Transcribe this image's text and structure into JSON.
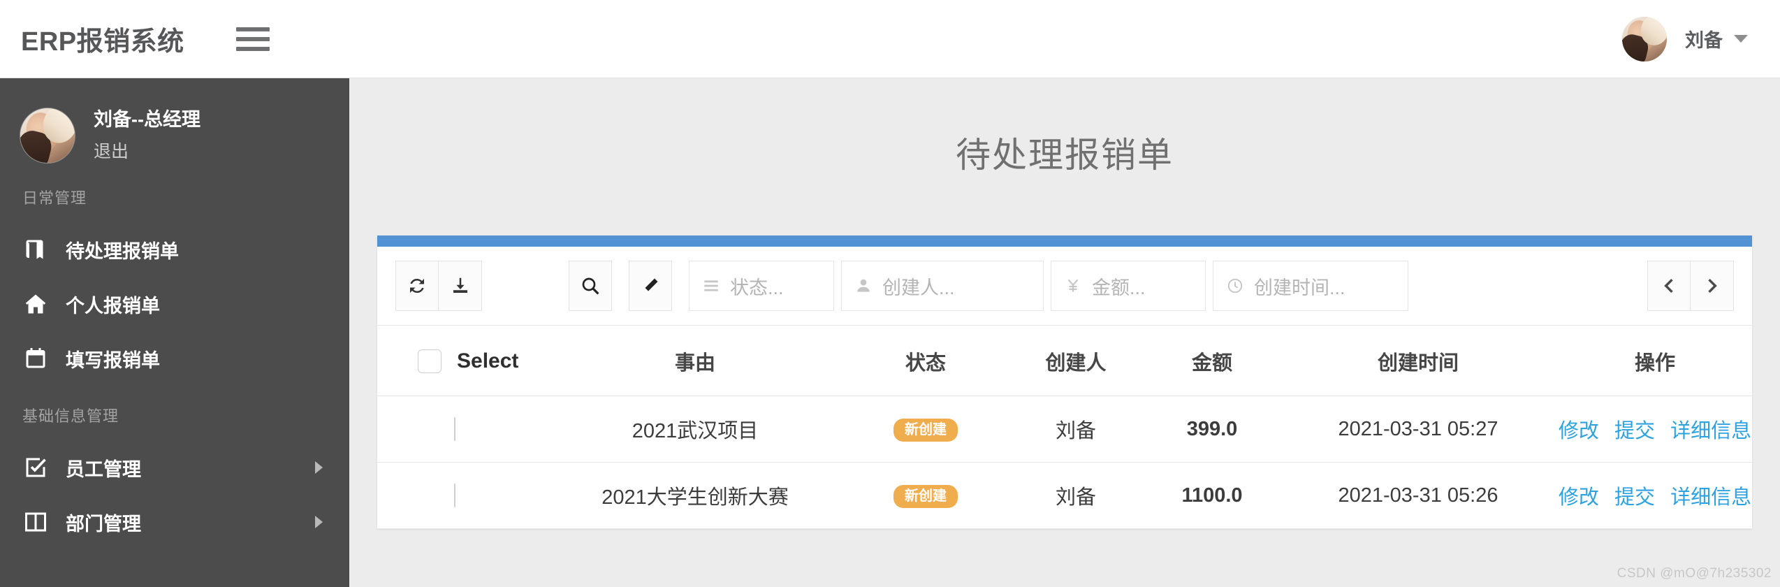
{
  "header": {
    "brand": "ERP报销系统",
    "menu_icon": "hamburger-icon",
    "user_name": "刘备"
  },
  "sidebar": {
    "user": {
      "name": "刘备--总经理",
      "logout": "退出"
    },
    "sections": [
      {
        "label": "日常管理",
        "items": [
          {
            "label": "待处理报销单",
            "icon": "book-icon",
            "has_chevron": false
          },
          {
            "label": "个人报销单",
            "icon": "home-icon",
            "has_chevron": false
          },
          {
            "label": "填写报销单",
            "icon": "calendar-icon",
            "has_chevron": false
          }
        ]
      },
      {
        "label": "基础信息管理",
        "items": [
          {
            "label": "员工管理",
            "icon": "check-circle-icon",
            "has_chevron": true
          },
          {
            "label": "部门管理",
            "icon": "columns-icon",
            "has_chevron": true
          }
        ]
      }
    ]
  },
  "main": {
    "page_title": "待处理报销单",
    "accent_color": "#5192d4"
  },
  "toolbar": {
    "refresh_icon": "refresh-icon",
    "download_icon": "download-icon",
    "search_icon": "search-icon",
    "eraser_icon": "eraser-icon",
    "status_filter": {
      "icon": "list-icon",
      "placeholder": "状态..."
    },
    "creator_filter": {
      "icon": "user-icon",
      "placeholder": "创建人..."
    },
    "amount_filter": {
      "icon": "yen-icon",
      "placeholder": "金额..."
    },
    "time_filter": {
      "icon": "clock-icon",
      "placeholder": "创建时间..."
    },
    "prev_icon": "chevron-left-icon",
    "next_icon": "chevron-right-icon"
  },
  "table": {
    "columns": [
      "Select",
      "事由",
      "状态",
      "创建人",
      "金额",
      "创建时间",
      "操作"
    ],
    "rows": [
      {
        "selected": false,
        "reason": "2021武汉项目",
        "status": "新创建",
        "creator": "刘备",
        "amount": "399.0",
        "created_at": "2021-03-31 05:27",
        "actions": [
          "修改",
          "提交",
          "详细信息"
        ]
      },
      {
        "selected": false,
        "reason": "2021大学生创新大赛",
        "status": "新创建",
        "creator": "刘备",
        "amount": "1100.0",
        "created_at": "2021-03-31 05:26",
        "actions": [
          "修改",
          "提交",
          "详细信息"
        ]
      }
    ],
    "status_badge_color": "#f0ad4e",
    "action_link_color": "#2da2e0"
  },
  "watermark": "CSDN @mO@7h235302"
}
